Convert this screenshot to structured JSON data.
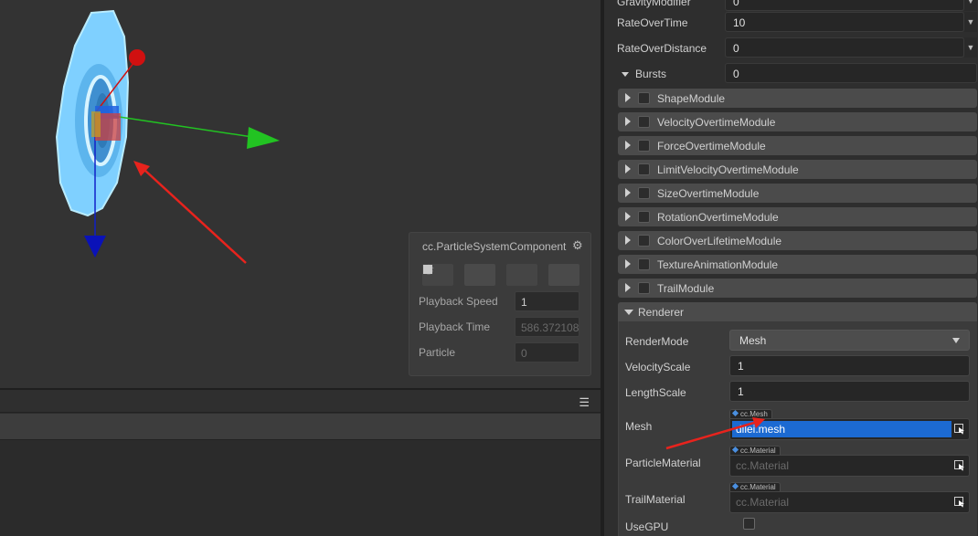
{
  "inspector": {
    "top_props": [
      {
        "label": "GravityModifier",
        "value": "0"
      },
      {
        "label": "RateOverTime",
        "value": "10"
      },
      {
        "label": "RateOverDistance",
        "value": "0"
      },
      {
        "label": "Bursts",
        "value": "0"
      }
    ],
    "modules": [
      "ShapeModule",
      "VelocityOvertimeModule",
      "ForceOvertimeModule",
      "LimitVelocityOvertimeModule",
      "SizeOvertimeModule",
      "RotationOvertimeModule",
      "ColorOverLifetimeModule",
      "TextureAnimationModule",
      "TrailModule"
    ],
    "renderer": {
      "title": "Renderer",
      "render_mode_label": "RenderMode",
      "render_mode_value": "Mesh",
      "velocity_scale_label": "VelocityScale",
      "velocity_scale_value": "1",
      "length_scale_label": "LengthScale",
      "length_scale_value": "1",
      "mesh_label": "Mesh",
      "mesh_type": "cc.Mesh",
      "mesh_value": "dilei.mesh",
      "particle_material_label": "ParticleMaterial",
      "particle_material_type": "cc.Material",
      "particle_material_value": "cc.Material",
      "trail_material_label": "TrailMaterial",
      "trail_material_type": "cc.Material",
      "trail_material_value": "cc.Material",
      "use_gpu_label": "UseGPU"
    }
  },
  "particle_panel": {
    "title": "cc.ParticleSystemComponent",
    "playback_speed_label": "Playback Speed",
    "playback_speed_value": "1",
    "playback_time_label": "Playback Time",
    "playback_time_value": "586.372108",
    "particle_label": "Particle",
    "particle_value": "0"
  },
  "colors": {
    "accent_selection": "#1c6ad2",
    "annotation_arrow": "#e8231d",
    "gizmo_x": "#22c322",
    "gizmo_y": "#d01010",
    "gizmo_z": "#1020c8"
  }
}
